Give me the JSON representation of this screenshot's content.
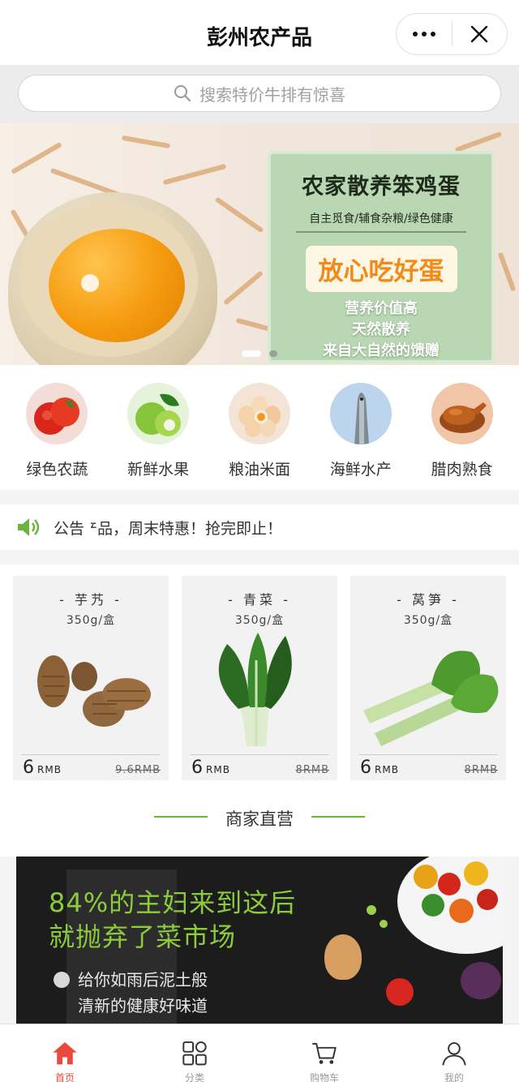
{
  "header": {
    "title": "彭州农产品"
  },
  "search": {
    "placeholder": "搜索特价牛排有惊喜"
  },
  "banner": {
    "title": "农家散养笨鸡蛋",
    "subtitle": "自主觅食/辅食杂粮/绿色健康",
    "headline": "放心吃好蛋",
    "features": [
      "营养价值高",
      "天然散养",
      "来自大自然的馈赠"
    ],
    "slide_count": 2,
    "active_slide": 1
  },
  "categories": [
    {
      "label": "绿色农蔬",
      "icon": "tomato-icon"
    },
    {
      "label": "新鲜水果",
      "icon": "apple-icon"
    },
    {
      "label": "粮油米面",
      "icon": "eggs-icon"
    },
    {
      "label": "海鲜水产",
      "icon": "fish-icon"
    },
    {
      "label": "腊肉熟食",
      "icon": "roast-chicken-icon"
    }
  ],
  "notice": {
    "label": "公告",
    "text": "农产品，周末特惠！抢完即止！"
  },
  "products": [
    {
      "name": "- 芋艿 -",
      "spec": "350g/盒",
      "price": "6",
      "unit": "RMB",
      "old_price": "9.6RMB"
    },
    {
      "name": "- 青菜 -",
      "spec": "350g/盒",
      "price": "6",
      "unit": "RMB",
      "old_price": "8RMB"
    },
    {
      "name": "- 莴笋 -",
      "spec": "350g/盒",
      "price": "6",
      "unit": "RMB",
      "old_price": "8RMB"
    }
  ],
  "section": {
    "title": "商家直营"
  },
  "promo": {
    "line1": "84%的主妇来到这后",
    "line2": "就抛弃了菜市场",
    "sub1": "给你如雨后泥土般",
    "sub2": "清新的健康好味道"
  },
  "tabs": [
    {
      "label": "首页",
      "icon": "home-icon",
      "active": true
    },
    {
      "label": "分类",
      "icon": "category-icon",
      "active": false
    },
    {
      "label": "购物车",
      "icon": "cart-icon",
      "active": false
    },
    {
      "label": "我的",
      "icon": "user-icon",
      "active": false
    }
  ],
  "colors": {
    "accent": "#6cb33f",
    "active_tab": "#e84b3c",
    "promo_text": "#8ccc3c"
  }
}
